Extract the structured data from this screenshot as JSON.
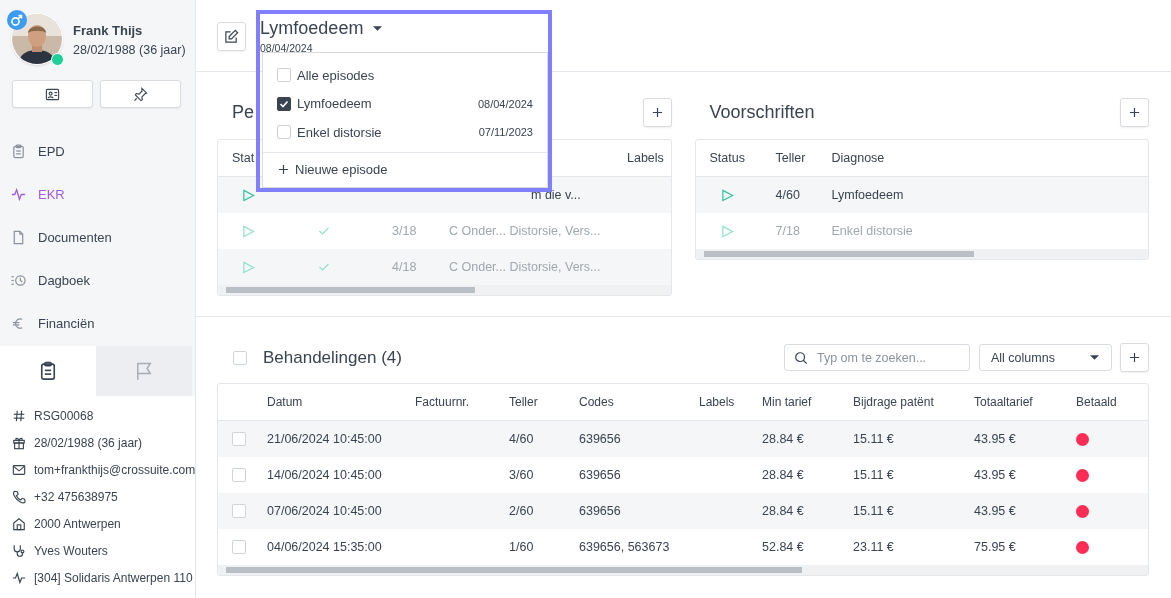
{
  "patient": {
    "name": "Frank Thijs",
    "birth": "28/02/1988 (36 jaar)",
    "online": true
  },
  "nav": [
    {
      "label": "EPD",
      "selected": false
    },
    {
      "label": "EKR",
      "selected": true
    },
    {
      "label": "Documenten",
      "selected": false
    },
    {
      "label": "Dagboek",
      "selected": false
    },
    {
      "label": "Financiën",
      "selected": false
    }
  ],
  "side_tabs": [
    {
      "selected": true
    },
    {
      "selected": false
    }
  ],
  "info": [
    "RSG00068",
    "28/02/1988 (36 jaar)",
    "tom+frankthijs@crossuite.com",
    "+32 475638975",
    "2000 Antwerpen",
    "Yves Wouters",
    "[304] Solidaris Antwerpen 110"
  ],
  "episode": {
    "title": "Lymfoedeem",
    "date": "08/04/2024"
  },
  "episode_menu": {
    "items": [
      {
        "label": "Alle episodes",
        "checked": false
      },
      {
        "label": "Lymfoedeem",
        "date": "08/04/2024",
        "checked": true
      },
      {
        "label": "Enkel distorsie",
        "date": "07/11/2023",
        "checked": false
      }
    ],
    "new_label": "Nieuwe episode"
  },
  "pe_panel": {
    "title": "Pe",
    "columns": [
      "Stat",
      "Labels"
    ],
    "rows": [
      {
        "active": true,
        "done": false,
        "diagnose": "m die v..."
      },
      {
        "active": false,
        "done": true,
        "teller": "3/18",
        "diagnose": "C Onder... Distorsie, Vers..."
      },
      {
        "active": false,
        "done": true,
        "teller": "4/18",
        "diagnose": "C Onder... Distorsie, Vers..."
      }
    ]
  },
  "voorschriften": {
    "title": "Voorschriften",
    "columns": [
      "Status",
      "Teller",
      "Diagnose"
    ],
    "rows": [
      {
        "active": true,
        "teller": "4/60",
        "diagnose": "Lymfoedeem"
      },
      {
        "active": false,
        "teller": "7/18",
        "diagnose": "Enkel distorsie"
      }
    ]
  },
  "behandelingen": {
    "checked": false,
    "title": "Behandelingen (4)",
    "search": {
      "placeholder": "Typ om te zoeken..."
    },
    "filter": "All columns",
    "columns": [
      "Datum",
      "Factuurnr.",
      "Teller",
      "Codes",
      "Labels",
      "Min tarief",
      "Bijdrage patënt",
      "Totaaltarief",
      "Betaald"
    ],
    "rows": [
      {
        "checked": false,
        "datum": "21/06/2024 10:45:00",
        "teller": "4/60",
        "codes": "639656",
        "min": "28.84 €",
        "bijdrage": "15.11 €",
        "totaal": "43.95 €",
        "color": "#ff2d55"
      },
      {
        "checked": false,
        "datum": "14/06/2024 10:45:00",
        "teller": "3/60",
        "codes": "639656",
        "min": "28.84 €",
        "bijdrage": "15.11 €",
        "totaal": "43.95 €",
        "color": "#ff2d55"
      },
      {
        "checked": false,
        "datum": "07/06/2024 10:45:00",
        "teller": "2/60",
        "codes": "639656",
        "min": "28.84 €",
        "bijdrage": "15.11 €",
        "totaal": "43.95 €",
        "color": "#ff2d55"
      },
      {
        "checked": false,
        "datum": "04/06/2024 15:35:00",
        "teller": "1/60",
        "codes": "639656, 563673",
        "min": "52.84 €",
        "bijdrage": "23.11 €",
        "totaal": "75.95 €",
        "color": "#ff2d55"
      }
    ]
  }
}
